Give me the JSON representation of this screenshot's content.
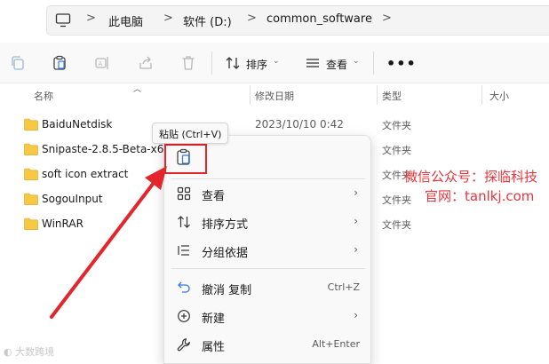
{
  "address_bar": {
    "crumbs": [
      "此电脑",
      "软件 (D:)",
      "common_software"
    ],
    "separator": ">"
  },
  "toolbar": {
    "sort_label": "排序",
    "view_label": "查看",
    "more_label": "•••",
    "icons": [
      "copy-icon",
      "paste-icon",
      "rename-icon",
      "share-icon",
      "delete-icon",
      "sort-icon",
      "view-icon"
    ]
  },
  "columns": {
    "name": "名称",
    "date": "修改日期",
    "type": "类型",
    "size": "大小"
  },
  "files": [
    {
      "name": "BaiduNetdisk",
      "date": "2023/10/10 0:42",
      "type": "文件夹"
    },
    {
      "name": "Snipaste-2.8.5-Beta-x64",
      "date": "",
      "type": "文件夹"
    },
    {
      "name": "soft icon extract",
      "date": "",
      "type": "文件夹"
    },
    {
      "name": "SogouInput",
      "date": "",
      "type": "文件夹"
    },
    {
      "name": "WinRAR",
      "date": "",
      "type": "文件夹"
    }
  ],
  "tooltip": "粘贴 (Ctrl+V)",
  "context_menu": {
    "items": [
      {
        "label": "查看",
        "shortcut": "",
        "submenu": true,
        "icon": "grid-icon"
      },
      {
        "label": "排序方式",
        "shortcut": "",
        "submenu": true,
        "icon": "sort-icon"
      },
      {
        "label": "分组依据",
        "shortcut": "",
        "submenu": true,
        "icon": "group-icon"
      },
      {
        "label": "撤消 复制",
        "shortcut": "Ctrl+Z",
        "submenu": false,
        "icon": "undo-icon"
      },
      {
        "label": "新建",
        "shortcut": "",
        "submenu": true,
        "icon": "new-icon"
      },
      {
        "label": "属性",
        "shortcut": "Alt+Enter",
        "submenu": false,
        "icon": "wrench-icon"
      }
    ],
    "arrow": "›"
  },
  "watermark": {
    "line1": "微信公众号：探临科技",
    "line2": "官网：tanlkj.com",
    "corner": "大数跨境"
  },
  "colors": {
    "accent_red": "#e3262b",
    "folder_yellow": "#f7c844",
    "menu_bg": "#f9f9f9"
  }
}
